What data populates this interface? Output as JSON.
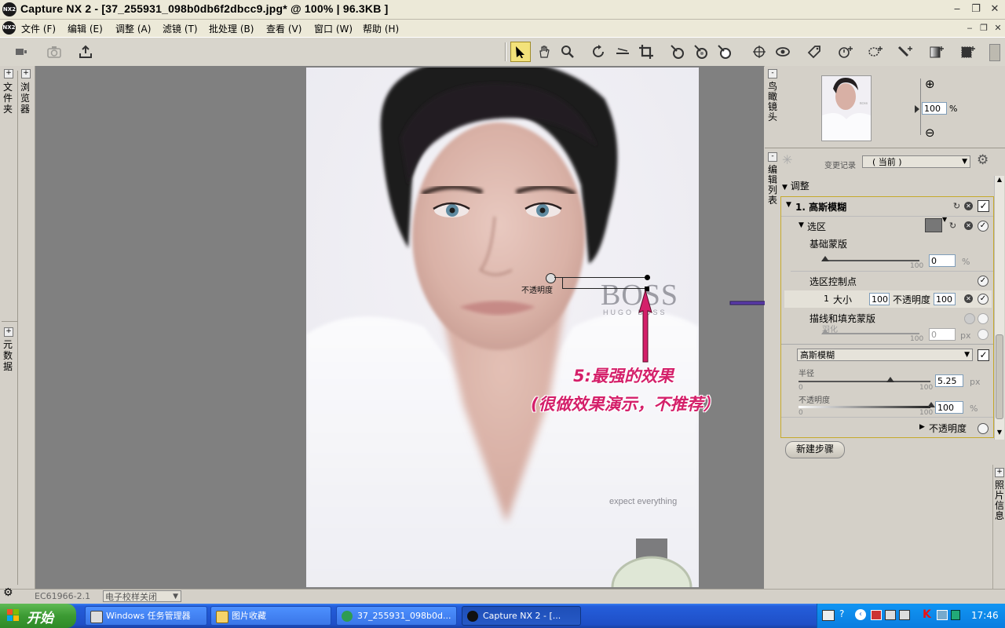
{
  "window": {
    "title": "Capture  NX 2 - [37_255931_098b0db6f2dbcc9.jpg* @ 100% | 96.3KB ]",
    "logo_text": "NX2"
  },
  "menu": [
    {
      "label": "文件 (F)"
    },
    {
      "label": "编辑 (E)"
    },
    {
      "label": "调整 (A)"
    },
    {
      "label": "滤镜 (T)"
    },
    {
      "label": "批处理 (B)"
    },
    {
      "label": "查看 (V)"
    },
    {
      "label": "窗口 (W)"
    },
    {
      "label": "帮助 (H)"
    }
  ],
  "left_dock": {
    "tab_folder": "文件夹",
    "tab_browser": "浏览器",
    "tab_metadata": "元数据"
  },
  "photo": {
    "brand": "BOSS",
    "brand_sub": "HUGO BOSS",
    "tagline": "expect everything",
    "control_point_label": "不透明度"
  },
  "annotation": {
    "line1": "5:最强的效果",
    "line2": "(很做效果演示，不推荐）"
  },
  "status": {
    "left": "EC61966-2.1",
    "dropdown": "电子校样关闭"
  },
  "birdseye": {
    "tab": "鸟瞰镜头",
    "zoom_value": "100",
    "zoom_unit": "%"
  },
  "edit_list": {
    "tab": "编辑列表",
    "history_label": "变更记录",
    "history_value": "( 当前 )",
    "section_adjust": "调整",
    "step_title": "1. 高斯模糊",
    "selection_label": "选区",
    "base_mask_label": "基础蒙版",
    "base_mask_value": "0",
    "base_mask_unit": "%",
    "slider_max": "100",
    "cp_label": "选区控制点",
    "cp_index": "1",
    "cp_size_label": "大小",
    "cp_size_value": "100",
    "cp_opacity_label": "不透明度",
    "cp_opacity_value": "100",
    "stroke_fill_label": "描线和填充蒙版",
    "feather_label": "羽化",
    "feather_value": "0",
    "feather_unit": "px",
    "filter_select": "高斯模糊",
    "radius_label": "半径",
    "radius_min": "0",
    "radius_max": "100",
    "radius_value": "5.25",
    "radius_unit": "px",
    "opacity_label": "不透明度",
    "opacity_min": "0",
    "opacity_max": "100",
    "opacity_value": "100",
    "opacity_unit": "%",
    "opacity_expand_label": "不透明度",
    "new_step": "新建步骤"
  },
  "photo_info_tab": "照片信息",
  "taskbar": {
    "start": "开始",
    "tasks": [
      {
        "label": "Windows 任务管理器"
      },
      {
        "label": "图片收藏"
      },
      {
        "label": "37_255931_098b0d..."
      },
      {
        "label": "Capture NX 2 - [..."
      }
    ],
    "clock": "17:46"
  }
}
